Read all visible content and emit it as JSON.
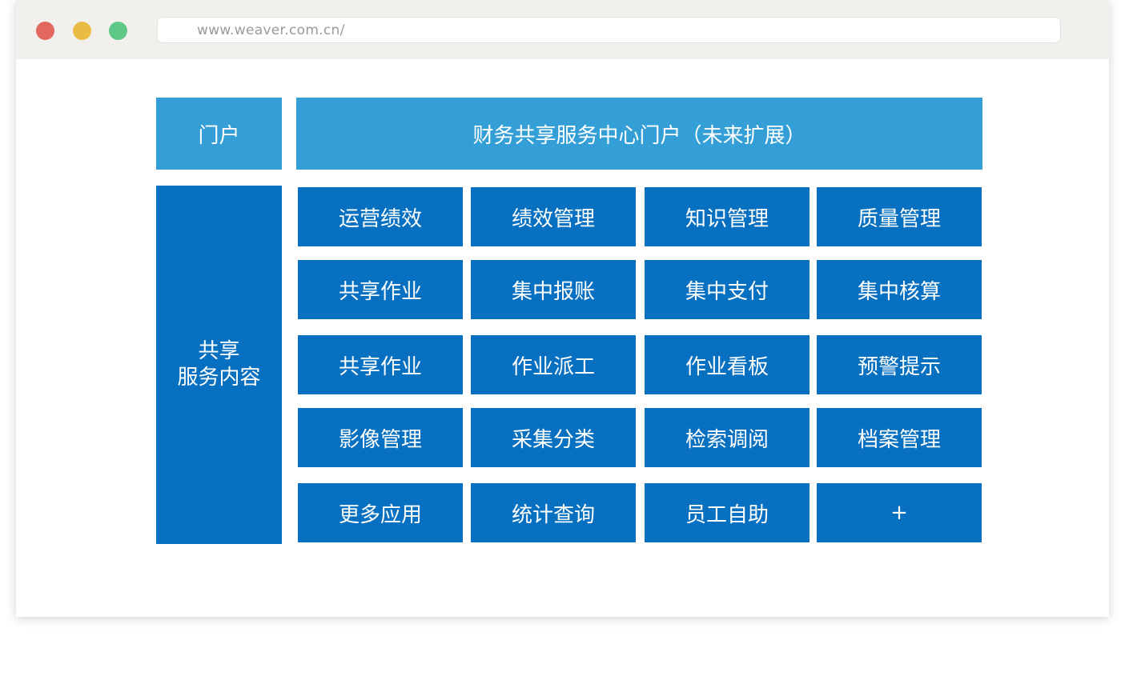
{
  "browser": {
    "url": "www.weaver.com.cn/",
    "dots": [
      {
        "name": "close-dot",
        "color": "#e2675f"
      },
      {
        "name": "minimize-dot",
        "color": "#ebbc43"
      },
      {
        "name": "maximize-dot",
        "color": "#5ec889"
      }
    ]
  },
  "colors": {
    "portal": "#349fd6",
    "service": "#0770c0"
  },
  "portal": {
    "label": "门户",
    "title": "财务共享服务中心门户（未来扩展）"
  },
  "shared_service": {
    "label_line1": "共享",
    "label_line2": "服务内容"
  },
  "grid": {
    "rows": [
      [
        "运营绩效",
        "绩效管理",
        "知识管理",
        "质量管理"
      ],
      [
        "共享作业",
        "集中报账",
        "集中支付",
        "集中核算"
      ],
      [
        "共享作业",
        "作业派工",
        "作业看板",
        "预警提示"
      ],
      [
        "影像管理",
        "采集分类",
        "检索调阅",
        "档案管理"
      ],
      [
        "更多应用",
        "统计查询",
        "员工自助",
        "+"
      ]
    ]
  }
}
